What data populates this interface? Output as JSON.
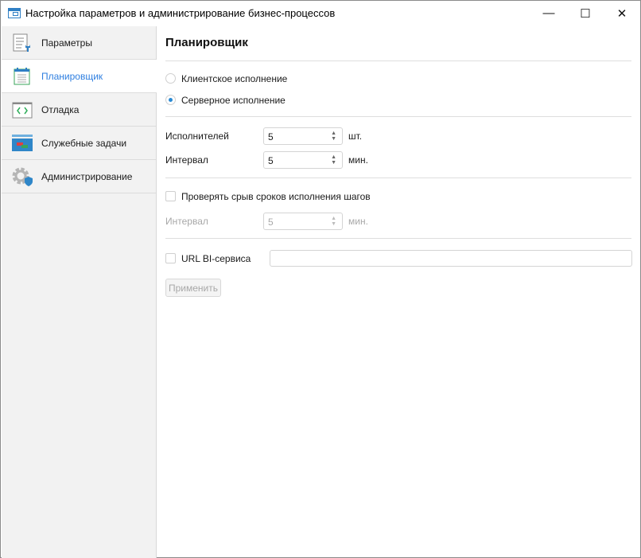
{
  "window": {
    "title": "Настройка параметров и администрирование бизнес-процессов",
    "minimize": "—",
    "maximize": "☐",
    "close": "✕"
  },
  "sidebar": {
    "items": [
      {
        "label": "Параметры",
        "icon": "settings-list-icon"
      },
      {
        "label": "Планировщик",
        "icon": "calendar-icon",
        "selected": true
      },
      {
        "label": "Отладка",
        "icon": "code-icon"
      },
      {
        "label": "Служебные задачи",
        "icon": "tasks-icon"
      },
      {
        "label": "Администрирование",
        "icon": "gear-shield-icon"
      }
    ]
  },
  "main": {
    "title": "Планировщик",
    "execution": {
      "client": "Клиентское исполнение",
      "server": "Серверное исполнение",
      "selected": "server"
    },
    "executors": {
      "label": "Исполнителей",
      "value": "5",
      "unit": "шт."
    },
    "interval": {
      "label": "Интервал",
      "value": "5",
      "unit": "мин."
    },
    "check_deadlines": {
      "label": "Проверять срыв сроков исполнения шагов",
      "checked": false
    },
    "deadline_interval": {
      "label": "Интервал",
      "value": "5",
      "unit": "мин."
    },
    "bi_url": {
      "label": "URL BI-сервиса",
      "checked": false,
      "value": ""
    },
    "apply": "Применить"
  }
}
